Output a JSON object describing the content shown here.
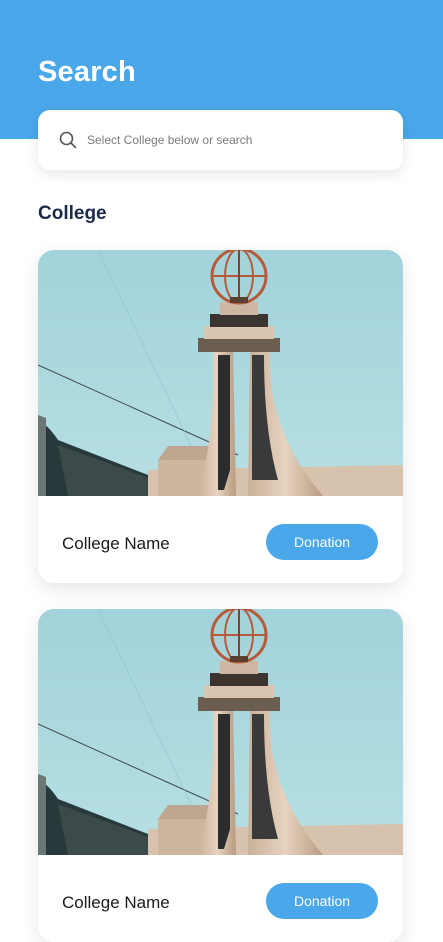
{
  "header": {
    "title": "Search"
  },
  "search": {
    "placeholder": "Select College below or search"
  },
  "section": {
    "title": "College"
  },
  "cards": [
    {
      "name": "College Name",
      "button_label": "Donation"
    },
    {
      "name": "College Name",
      "button_label": "Donation"
    }
  ],
  "colors": {
    "accent": "#4aa8ea",
    "section_title": "#1d2b4a",
    "sky": "#a9d7dd"
  },
  "icons": {
    "search": "search-icon"
  }
}
